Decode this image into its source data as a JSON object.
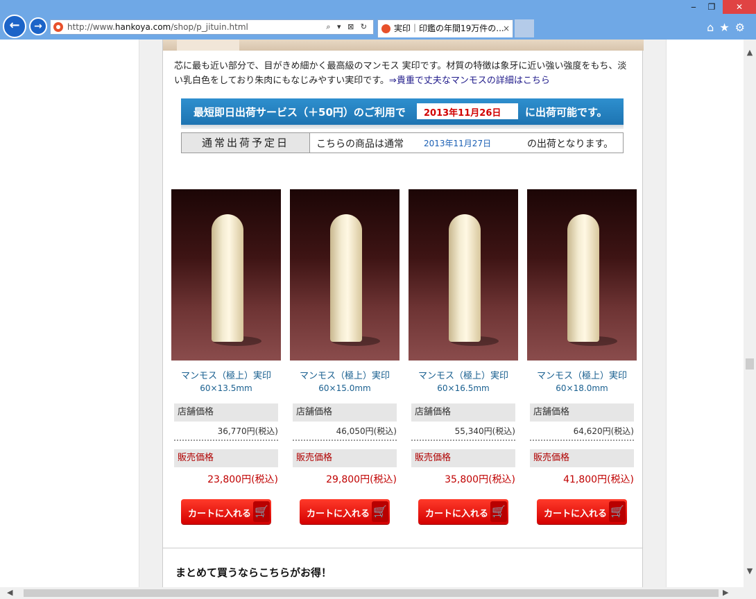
{
  "browser": {
    "url_prefix": "http://www.",
    "url_domain": "hankoya.com",
    "url_path": "/shop/p_jituin.html",
    "tab_title": "実印｜印鑑の年間19万件の...",
    "tab_close": "×",
    "addr_tools": "⌕ ▾ ⊠ ↻",
    "icons": [
      "back-arrow-icon",
      "forward-arrow-icon",
      "home-icon",
      "favorites-star-icon",
      "settings-gear-icon"
    ]
  },
  "page": {
    "description": "芯に最も近い部分で、目がきめ細かく最高級のマンモス 実印です。材質の特徴は象牙に近い強い強度をもち、淡い乳白色をしており朱肉にもなじみやすい実印です。",
    "description_link": "⇒貴重で丈夫なマンモスの詳細はこちら",
    "express": {
      "text_before": "最短即日出荷サービス（＋50円）のご利用で",
      "date": "2013年11月26日",
      "text_after": "に出荷可能です。"
    },
    "normal": {
      "label": "通常出荷予定日",
      "text_before": "こちらの商品は通常",
      "date": "2013年11月27日",
      "text_after": "の出荷となります。"
    },
    "products": [
      {
        "name": "マンモス（極上）実印",
        "size": "60×13.5mm",
        "store_label": "店舗価格",
        "store_price": "36,770円(税込)",
        "sale_label": "販売価格",
        "sale_price": "23,800円(税込)",
        "cart_label": "カートに入れる"
      },
      {
        "name": "マンモス（極上）実印",
        "size": "60×15.0mm",
        "store_label": "店舗価格",
        "store_price": "46,050円(税込)",
        "sale_label": "販売価格",
        "sale_price": "29,800円(税込)",
        "cart_label": "カートに入れる"
      },
      {
        "name": "マンモス（極上）実印",
        "size": "60×16.5mm",
        "store_label": "店舗価格",
        "store_price": "55,340円(税込)",
        "sale_label": "販売価格",
        "sale_price": "35,800円(税込)",
        "cart_label": "カートに入れる"
      },
      {
        "name": "マンモス（極上）実印",
        "size": "60×18.0mm",
        "store_label": "店舗価格",
        "store_price": "64,620円(税込)",
        "sale_label": "販売価格",
        "sale_price": "41,800円(税込)",
        "cart_label": "カートに入れる"
      }
    ],
    "bulk_title": "まとめて買うならこちらがお得！"
  },
  "colors": {
    "chrome": "#6fa8e6",
    "banner_blue": "#1d74b2",
    "sale_red": "#c00000",
    "cart_red": "#e00000",
    "link_blue": "#1a6090"
  }
}
